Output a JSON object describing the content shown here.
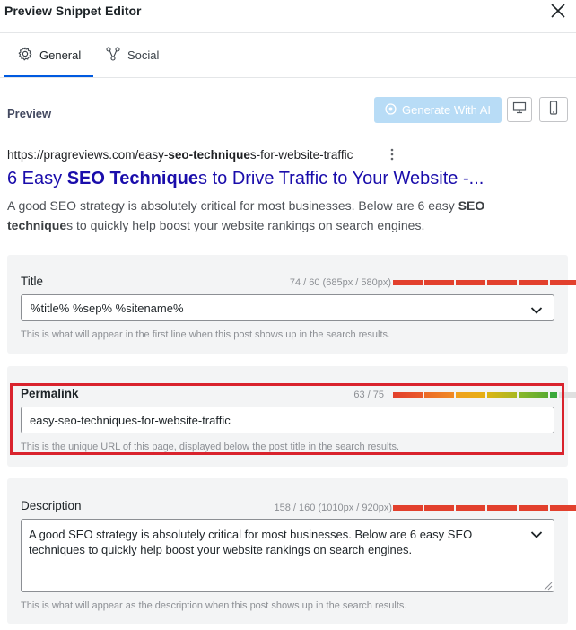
{
  "window": {
    "title": "Preview Snippet Editor"
  },
  "tabs": [
    {
      "label": "General",
      "active": true,
      "icon": "gear-icon"
    },
    {
      "label": "Social",
      "active": false,
      "icon": "share-network-icon"
    }
  ],
  "preview": {
    "label": "Preview",
    "generate_label": "Generate With AI",
    "snippet": {
      "url_pre": "https://pragreviews.com/easy-",
      "url_bold": "seo-technique",
      "url_post": "s-for-website-traffic",
      "title_pre": "6 Easy ",
      "title_bold": "SEO Technique",
      "title_post": "s to Drive Traffic to Your Website -...",
      "desc_pre": "A good SEO strategy is absolutely critical for most businesses. Below are 6 easy ",
      "desc_bold1": "SEO",
      "desc_mid": " ",
      "desc_bold2": "technique",
      "desc_post": "s to quickly help boost your website rankings on search engines."
    }
  },
  "title_field": {
    "label": "Title",
    "count": "74 / 60 (685px / 580px)",
    "value": "%title% %sep% %sitename%",
    "help": "This is what will appear in the first line when this post shows up in the search results.",
    "bar_color": "#e2402d"
  },
  "permalink_field": {
    "label": "Permalink",
    "count": "63 / 75",
    "value": "easy-seo-techniques-for-website-traffic",
    "help": "This is the unique URL of this page, displayed below the post title in the search results.",
    "gradient": [
      "#e2402d",
      "#f08a24",
      "#e6b012",
      "#8ab82a",
      "#3aa83a"
    ]
  },
  "description_field": {
    "label": "Description",
    "count": "158 / 160 (1010px / 920px)",
    "value": "A good SEO strategy is absolutely critical for most businesses. Below are 6 easy SEO techniques to quickly help boost your website rankings on search engines.",
    "help": "This is what will appear as the description when this post shows up in the search results.",
    "bar_color": "#e2402d"
  },
  "colors": {
    "accent": "#005ae0",
    "ai_button": "#b8dcf6",
    "link_title": "#1a0dab",
    "highlight": "#d9232d"
  }
}
